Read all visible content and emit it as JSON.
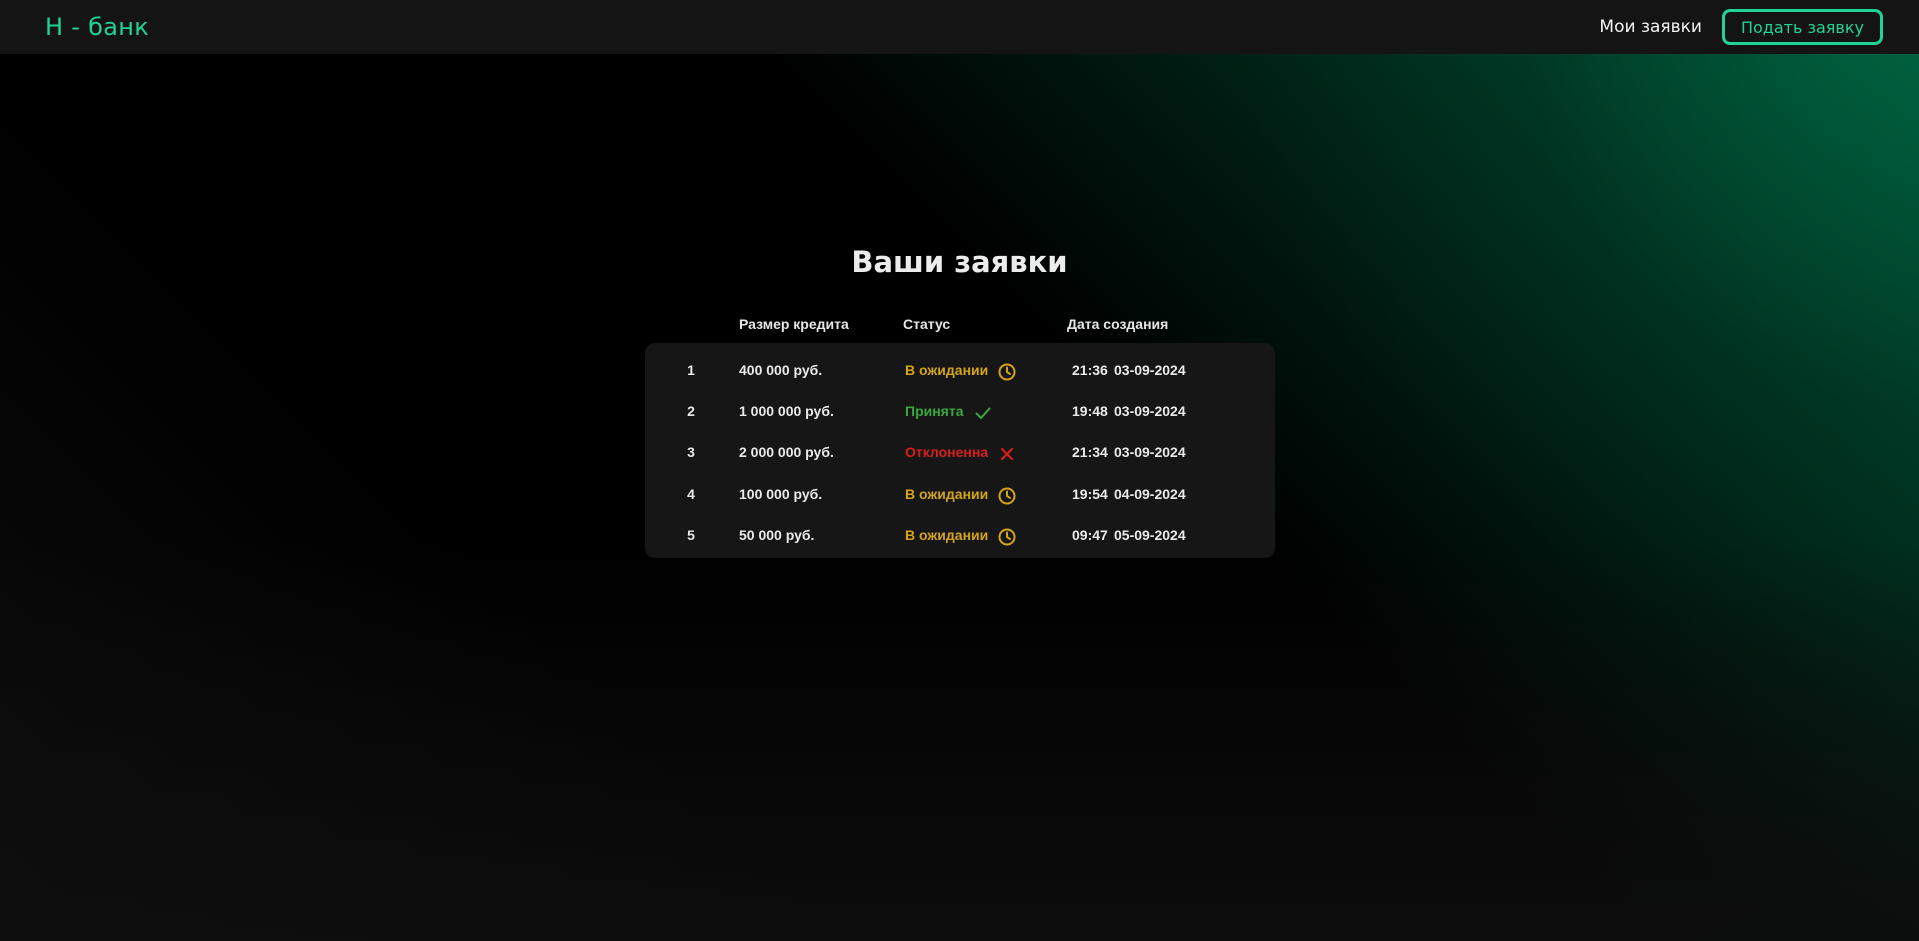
{
  "header": {
    "logo": "Н - банк",
    "nav_my_requests": "Мои заявки",
    "nav_submit_button": "Подать заявку"
  },
  "main": {
    "title": "Ваши заявки",
    "columns": {
      "amount": "Размер кредита",
      "status": "Статус",
      "date": "Дата создания"
    },
    "rows": [
      {
        "num": "1",
        "amount": "400 000 руб.",
        "status": "В ожидании",
        "status_type": "pending",
        "icon": "clock-icon",
        "time": "21:36",
        "date": "03-09-2024"
      },
      {
        "num": "2",
        "amount": "1 000 000 руб.",
        "status": "Принята",
        "status_type": "accepted",
        "icon": "check-icon",
        "time": "19:48",
        "date": "03-09-2024"
      },
      {
        "num": "3",
        "amount": "2 000 000 руб.",
        "status": "Отклоненна",
        "status_type": "rejected",
        "icon": "close-icon",
        "time": "21:34",
        "date": "03-09-2024"
      },
      {
        "num": "4",
        "amount": "100 000 руб.",
        "status": "В ожидании",
        "status_type": "pending",
        "icon": "clock-icon",
        "time": "19:54",
        "date": "04-09-2024"
      },
      {
        "num": "5",
        "amount": "50 000 руб.",
        "status": "В ожидании",
        "status_type": "pending",
        "icon": "clock-icon",
        "time": "09:47",
        "date": "05-09-2024"
      }
    ]
  },
  "colors": {
    "accent": "#1fd494",
    "pending": "#d4a41a",
    "accepted": "#3aa83a",
    "rejected": "#d8201e"
  }
}
